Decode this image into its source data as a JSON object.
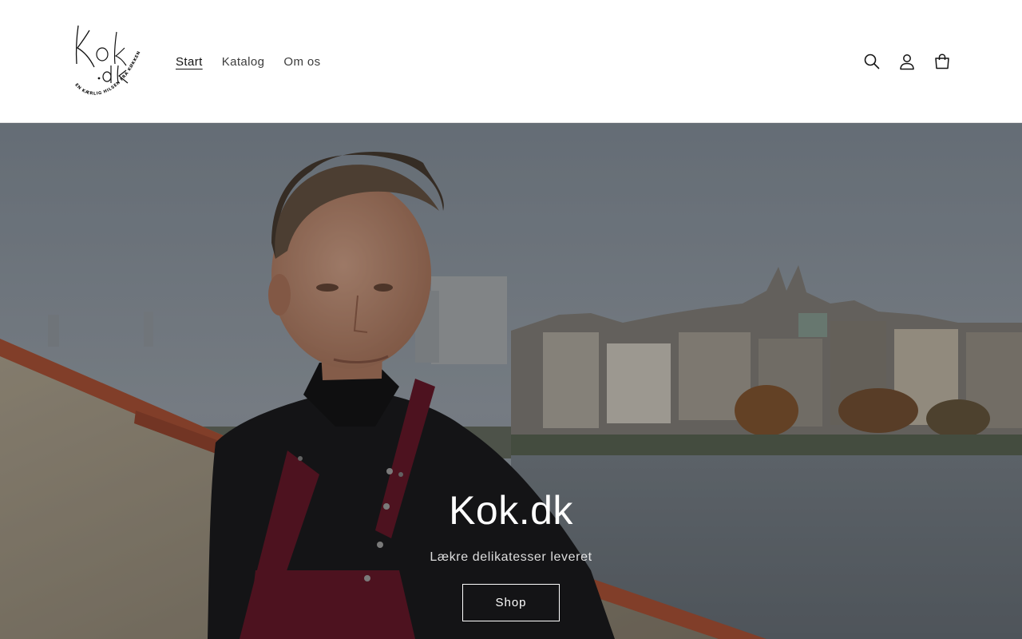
{
  "header": {
    "logo": {
      "text": "Kok.dk",
      "tagline": "EN KÆRLIG HILSEN FRA KØKKENET"
    },
    "nav": [
      {
        "label": "Start",
        "active": true
      },
      {
        "label": "Katalog",
        "active": false
      },
      {
        "label": "Om os",
        "active": false
      }
    ],
    "icons": [
      "search-icon",
      "account-icon",
      "cart-icon"
    ]
  },
  "hero": {
    "title": "Kok.dk",
    "subtitle": "Lækre delikatesser leveret",
    "button_label": "Shop"
  },
  "colors": {
    "header_bg": "#ffffff",
    "text": "#121212",
    "hero_text": "#ffffff",
    "apron": "#6b1a2c",
    "jacket": "#1c1d1f"
  }
}
